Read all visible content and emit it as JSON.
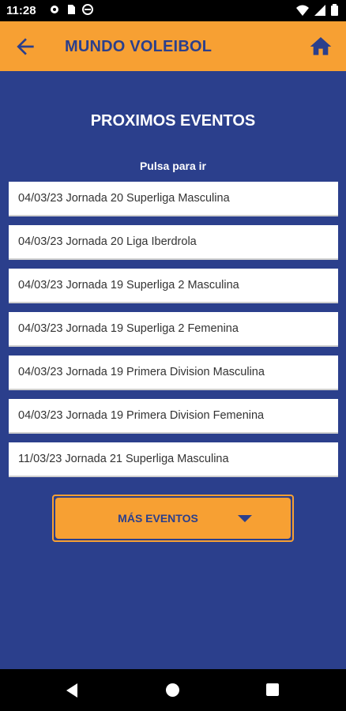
{
  "status_bar": {
    "time": "11:28",
    "left_icons": [
      "gear-icon",
      "sd-card-icon",
      "no-disturb-icon"
    ],
    "right_icons": [
      "wifi-icon",
      "signal-icon",
      "battery-icon"
    ]
  },
  "app_bar": {
    "title": "MUNDO VOLEIBOL",
    "back_icon": "arrow-left-icon",
    "home_icon": "home-icon"
  },
  "main": {
    "heading": "PROXIMOS EVENTOS",
    "subheading": "Pulsa para ir",
    "events": [
      "04/03/23 Jornada 20 Superliga Masculina",
      "04/03/23 Jornada 20 Liga Iberdrola",
      "04/03/23 Jornada 19 Superliga 2 Masculina",
      "04/03/23 Jornada 19 Superliga 2 Femenina",
      "04/03/23 Jornada 19 Primera Division Masculina",
      "04/03/23 Jornada 19 Primera Division Femenina",
      "11/03/23 Jornada 21 Superliga Masculina"
    ],
    "more_button": "MÁS EVENTOS"
  },
  "colors": {
    "accent": "#f7a033",
    "primary": "#2b3f8c"
  }
}
